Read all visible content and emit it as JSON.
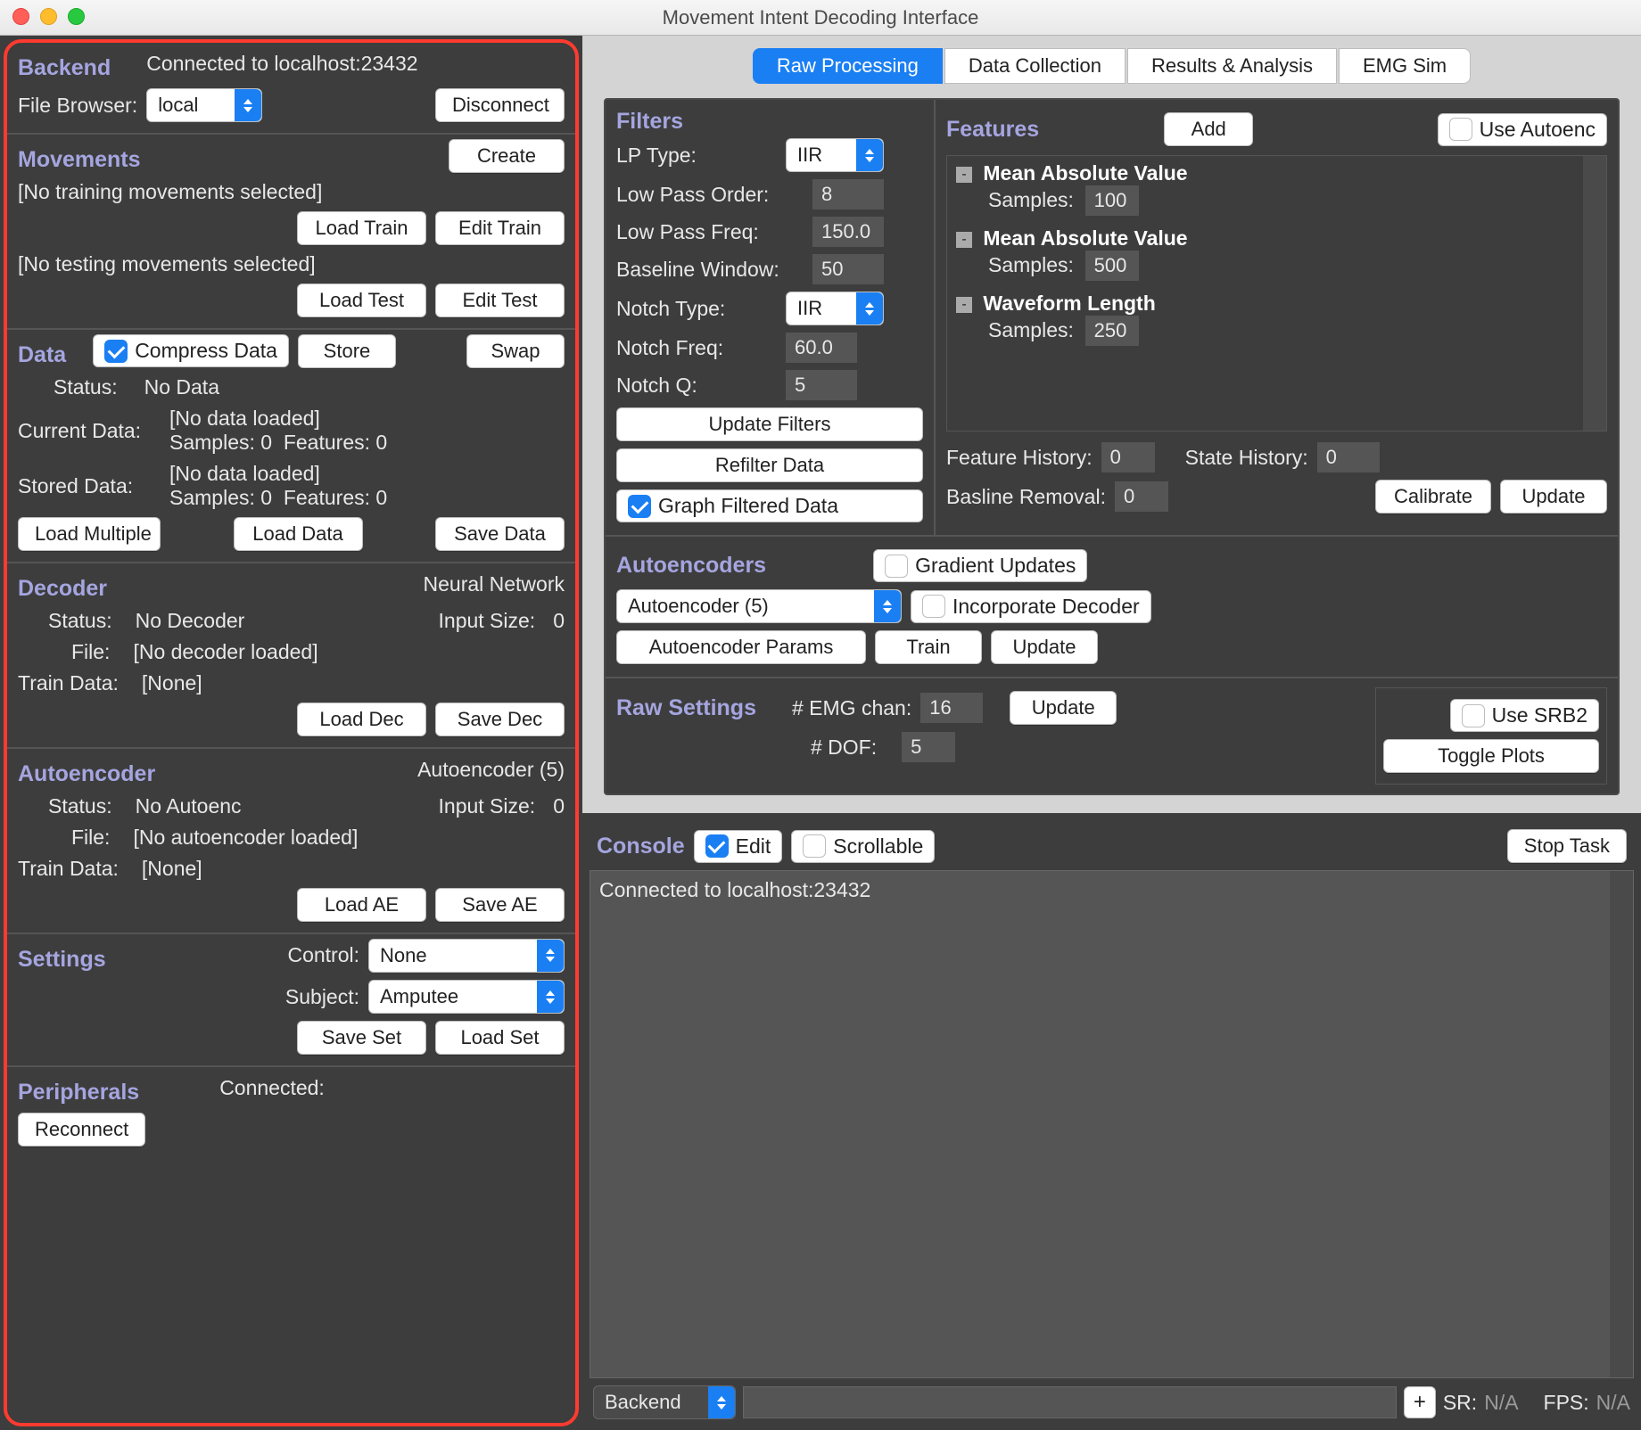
{
  "window": {
    "title": "Movement Intent Decoding Interface"
  },
  "left": {
    "backend": {
      "title": "Backend",
      "connected": "Connected to localhost:23432",
      "fileBrowserLabel": "File Browser:",
      "fileBrowserValue": "local",
      "disconnect": "Disconnect"
    },
    "movements": {
      "title": "Movements",
      "create": "Create",
      "noTrain": "[No training movements selected]",
      "loadTrain": "Load Train",
      "editTrain": "Edit Train",
      "noTest": "[No testing movements selected]",
      "loadTest": "Load Test",
      "editTest": "Edit Test"
    },
    "data": {
      "title": "Data",
      "compress": "Compress Data",
      "store": "Store",
      "swap": "Swap",
      "statusLabel": "Status:",
      "statusValue": "No Data",
      "currentLabel": "Current Data:",
      "currentLoaded": "[No data loaded]",
      "currentSamplesLabel": "Samples: 0",
      "currentFeaturesLabel": "Features: 0",
      "storedLabel": "Stored Data:",
      "storedLoaded": "[No data loaded]",
      "storedSamplesLabel": "Samples: 0",
      "storedFeaturesLabel": "Features: 0",
      "loadMultiple": "Load Multiple",
      "loadData": "Load Data",
      "saveData": "Save Data"
    },
    "decoder": {
      "title": "Decoder",
      "type": "Neural Network",
      "statusLabel": "Status:",
      "statusValue": "No Decoder",
      "inputSizeLabel": "Input Size:",
      "inputSizeValue": "0",
      "fileLabel": "File:",
      "fileValue": "[No decoder loaded]",
      "trainDataLabel": "Train Data:",
      "trainDataValue": "[None]",
      "loadDec": "Load Dec",
      "saveDec": "Save Dec"
    },
    "autoencoder": {
      "title": "Autoencoder",
      "type": "Autoencoder (5)",
      "statusLabel": "Status:",
      "statusValue": "No Autoenc",
      "inputSizeLabel": "Input Size:",
      "inputSizeValue": "0",
      "fileLabel": "File:",
      "fileValue": "[No autoencoder loaded]",
      "trainDataLabel": "Train Data:",
      "trainDataValue": "[None]",
      "loadAE": "Load AE",
      "saveAE": "Save AE"
    },
    "settings": {
      "title": "Settings",
      "controlLabel": "Control:",
      "controlValue": "None",
      "subjectLabel": "Subject:",
      "subjectValue": "Amputee",
      "saveSet": "Save Set",
      "loadSet": "Load Set"
    },
    "peripherals": {
      "title": "Peripherals",
      "connected": "Connected:",
      "reconnect": "Reconnect"
    }
  },
  "tabs": {
    "items": [
      "Raw Processing",
      "Data Collection",
      "Results & Analysis",
      "EMG Sim"
    ],
    "active": 0
  },
  "filters": {
    "title": "Filters",
    "lpTypeLabel": "LP Type:",
    "lpTypeValue": "IIR",
    "lpOrderLabel": "Low Pass Order:",
    "lpOrderValue": "8",
    "lpFreqLabel": "Low Pass Freq:",
    "lpFreqValue": "150.0",
    "baselineLabel": "Baseline Window:",
    "baselineValue": "50",
    "notchTypeLabel": "Notch Type:",
    "notchTypeValue": "IIR",
    "notchFreqLabel": "Notch Freq:",
    "notchFreqValue": "60.0",
    "notchQLabel": "Notch Q:",
    "notchQValue": "5",
    "updateFilters": "Update Filters",
    "refilterData": "Refilter Data",
    "graphFiltered": "Graph Filtered Data"
  },
  "features": {
    "title": "Features",
    "add": "Add",
    "useAutoenc": "Use Autoenc",
    "items": [
      {
        "name": "Mean Absolute Value",
        "samplesLabel": "Samples:",
        "samplesValue": "100"
      },
      {
        "name": "Mean Absolute Value",
        "samplesLabel": "Samples:",
        "samplesValue": "500"
      },
      {
        "name": "Waveform Length",
        "samplesLabel": "Samples:",
        "samplesValue": "250"
      }
    ],
    "featureHistoryLabel": "Feature History:",
    "featureHistoryValue": "0",
    "stateHistoryLabel": "State History:",
    "stateHistoryValue": "0",
    "baselineRemovalLabel": "Basline Removal:",
    "baselineRemovalValue": "0",
    "calibrate": "Calibrate",
    "update": "Update"
  },
  "autoencoders": {
    "title": "Autoencoders",
    "select": "Autoencoder (5)",
    "gradient": "Gradient Updates",
    "incorporate": "Incorporate Decoder",
    "params": "Autoencoder Params",
    "train": "Train",
    "update": "Update"
  },
  "rawSettings": {
    "title": "Raw Settings",
    "emgLabel": "# EMG chan:",
    "emgValue": "16",
    "dofLabel": "# DOF:",
    "dofValue": "5",
    "update": "Update",
    "useSRB2": "Use SRB2",
    "togglePlots": "Toggle Plots"
  },
  "console": {
    "title": "Console",
    "edit": "Edit",
    "scrollable": "Scrollable",
    "stopTask": "Stop Task",
    "content": "Connected to localhost:23432",
    "sourceSelect": "Backend",
    "plus": "+",
    "srLabel": "SR:",
    "srValue": "N/A",
    "fpsLabel": "FPS:",
    "fpsValue": "N/A"
  }
}
